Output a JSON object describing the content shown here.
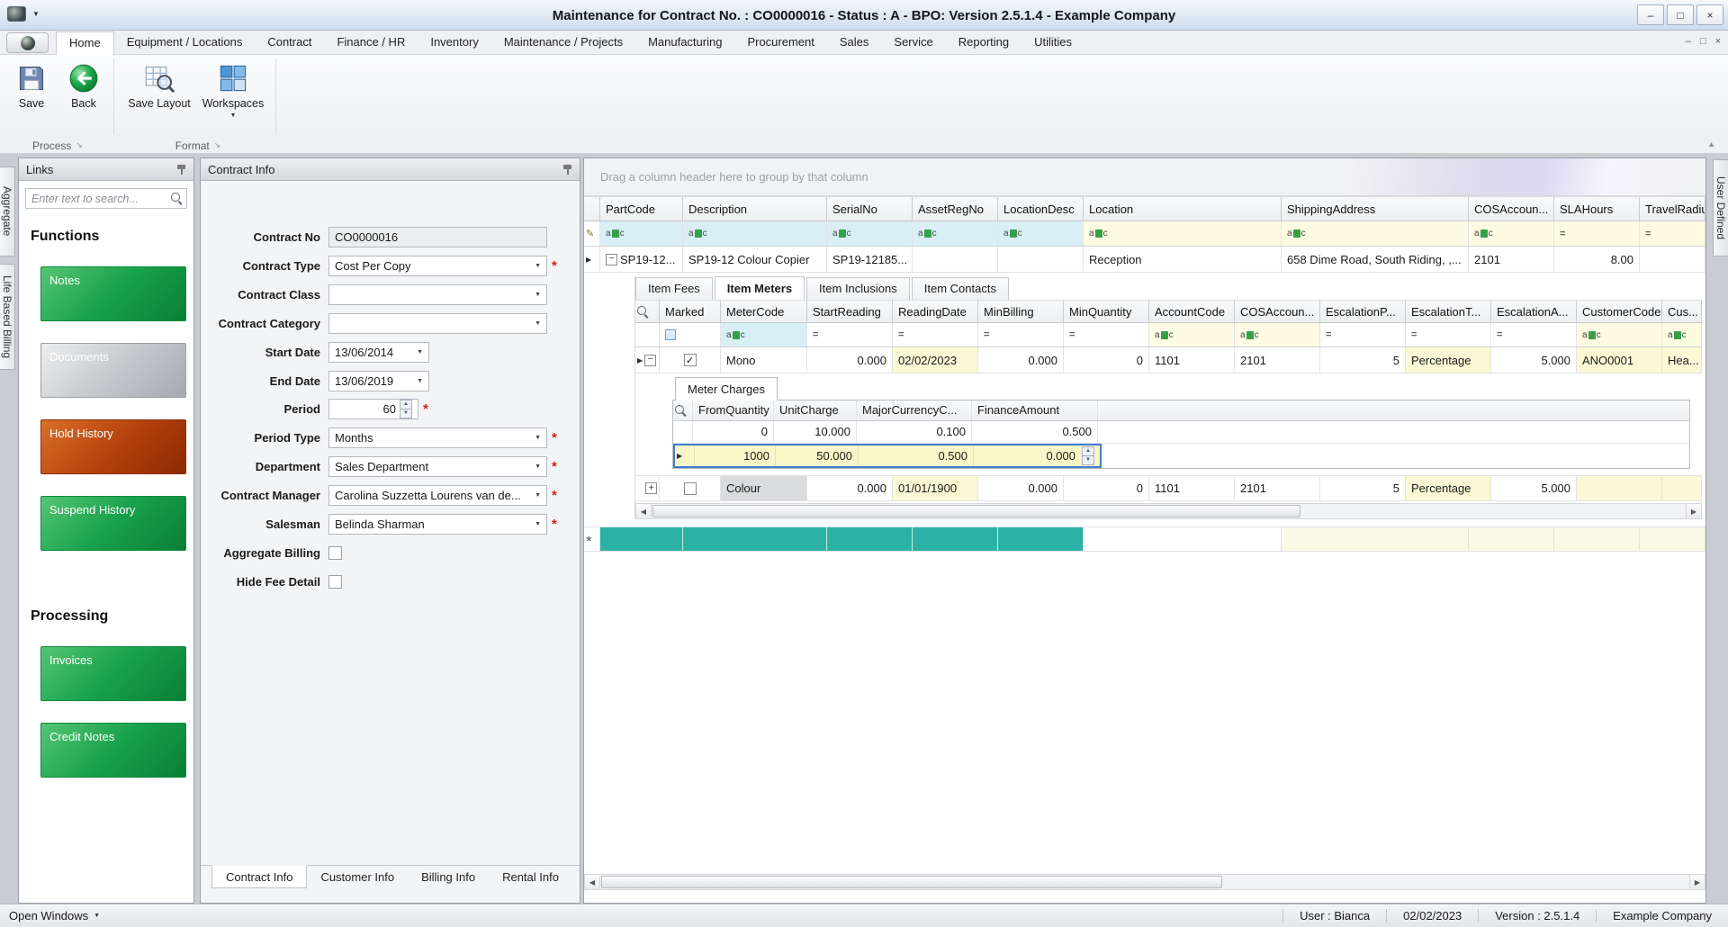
{
  "title_bar": {
    "title": "Maintenance for Contract No. : CO0000016 - Status : A - BPO: Version 2.5.1.4 - Example Company"
  },
  "ribbon": {
    "tabs": [
      "Home",
      "Equipment / Locations",
      "Contract",
      "Finance / HR",
      "Inventory",
      "Maintenance / Projects",
      "Manufacturing",
      "Procurement",
      "Sales",
      "Service",
      "Reporting",
      "Utilities"
    ],
    "save": "Save",
    "back": "Back",
    "save_layout": "Save Layout",
    "workspaces": "Workspaces",
    "group_process": "Process",
    "group_format": "Format"
  },
  "left_edge_tabs": {
    "aggregate": "Aggregate",
    "life_based_billing": "Life Based Billing"
  },
  "right_edge_tabs": {
    "user_defined": "User Defined"
  },
  "links": {
    "title": "Links",
    "search_placeholder": "Enter text to search...",
    "functions_heading": "Functions",
    "notes": "Notes",
    "documents": "Documents",
    "hold_history": "Hold History",
    "suspend_history": "Suspend History",
    "processing_heading": "Processing",
    "invoices": "Invoices",
    "credit_notes": "Credit Notes"
  },
  "contract": {
    "title": "Contract Info",
    "contract_no": {
      "label": "Contract No",
      "value": "CO0000016"
    },
    "contract_type": {
      "label": "Contract Type",
      "value": "Cost Per Copy"
    },
    "contract_class": {
      "label": "Contract Class",
      "value": ""
    },
    "contract_category": {
      "label": "Contract Category",
      "value": ""
    },
    "start_date": {
      "label": "Start Date",
      "value": "13/06/2014"
    },
    "end_date": {
      "label": "End Date",
      "value": "13/06/2019"
    },
    "period": {
      "label": "Period",
      "value": "60"
    },
    "period_type": {
      "label": "Period Type",
      "value": "Months"
    },
    "department": {
      "label": "Department",
      "value": "Sales Department"
    },
    "contract_manager": {
      "label": "Contract Manager",
      "value": "Carolina Suzzetta Lourens van de..."
    },
    "salesman": {
      "label": "Salesman",
      "value": "Belinda Sharman"
    },
    "aggregate_billing": {
      "label": "Aggregate Billing"
    },
    "hide_fee_detail": {
      "label": "Hide Fee Detail"
    },
    "tabs": [
      "Contract Info",
      "Customer Info",
      "Billing Info",
      "Rental Info"
    ]
  },
  "equipment_grid": {
    "group_hint": "Drag a column header here to group by that column",
    "columns": [
      "PartCode",
      "Description",
      "SerialNo",
      "AssetRegNo",
      "LocationDesc",
      "Location",
      "ShippingAddress",
      "COSAccoun...",
      "SLAHours",
      "TravelRadiu..."
    ],
    "row1": {
      "partcode": "SP19-12...",
      "description": "SP19-12 Colour Copier",
      "serialno": "SP19-12185...",
      "assetregno": "",
      "locationdesc": "",
      "location": "Reception",
      "shippingaddress": "658 Dime Road, South Riding, ,...",
      "cosaccount": "2101",
      "slahours": "8.00",
      "travelradius": ""
    }
  },
  "item_tabs": [
    "Item Fees",
    "Item Meters",
    "Item Inclusions",
    "Item Contacts"
  ],
  "meters_grid": {
    "columns": [
      "Marked",
      "MeterCode",
      "StartReading",
      "ReadingDate",
      "MinBilling",
      "MinQuantity",
      "AccountCode",
      "COSAccoun...",
      "EscalationP...",
      "EscalationT...",
      "EscalationA...",
      "CustomerCode",
      "Cus..."
    ],
    "row_mono": {
      "metercode": "Mono",
      "startreading": "0.000",
      "readingdate": "02/02/2023",
      "minbilling": "0.000",
      "minquantity": "0",
      "accountcode": "1101",
      "cosaccount": "2101",
      "escalationp": "5",
      "escalationt": "Percentage",
      "escalationa": "5.000",
      "customercode": "ANO0001",
      "cus": "Hea..."
    },
    "row_colour": {
      "metercode": "Colour",
      "startreading": "0.000",
      "readingdate": "01/01/1900",
      "minbilling": "0.000",
      "minquantity": "0",
      "accountcode": "1101",
      "cosaccount": "2101",
      "escalationp": "5",
      "escalationt": "Percentage",
      "escalationa": "5.000",
      "customercode": "",
      "cus": ""
    }
  },
  "meter_charges": {
    "tab": "Meter Charges",
    "columns": [
      "FromQuantity",
      "UnitCharge",
      "MajorCurrencyC...",
      "FinanceAmount"
    ],
    "row1": {
      "fromquantity": "0",
      "unitcharge": "10.000",
      "majorcurrency": "0.100",
      "financeamount": "0.500"
    },
    "row2": {
      "fromquantity": "1000",
      "unitcharge": "50.000",
      "majorcurrency": "0.500",
      "financeamount": "0.000"
    }
  },
  "status_bar": {
    "open_windows": "Open Windows",
    "user": "User : Bianca",
    "date": "02/02/2023",
    "version": "Version : 2.5.1.4",
    "company": "Example Company"
  },
  "icons": {
    "dropdown_arrow": "▼",
    "caret_down": "▼",
    "spin_up": "▲",
    "spin_down": "▼",
    "row_indicator": "▶",
    "expand_open": "−",
    "expand_closed": "+",
    "checkbox_check": "✓",
    "filter_equals": "=",
    "pencil": "✎",
    "new_row_marker": "*",
    "scroll_left": "◀",
    "scroll_right": "▶",
    "window_min": "–",
    "window_max": "□",
    "window_close": "×",
    "collapse_ribbon": "▲",
    "dialog_launcher": "↘"
  }
}
